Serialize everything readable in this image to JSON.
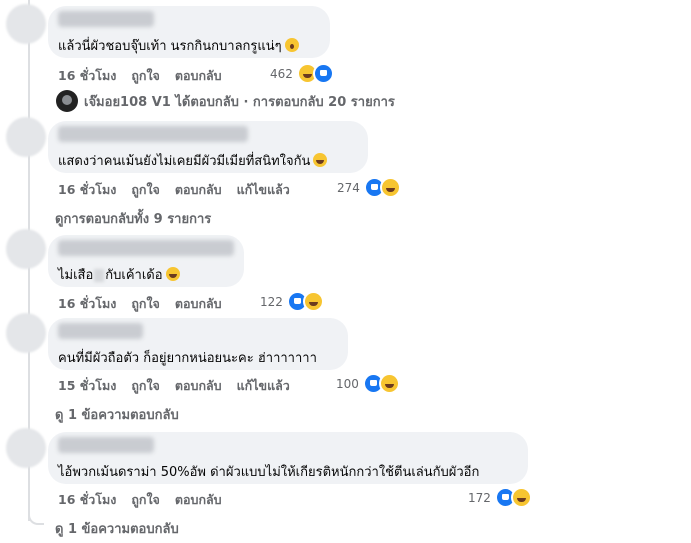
{
  "comments": [
    {
      "text": "แล้วนี่ผัวชอบจุ๊บเท้า นรกกินกบาลกรูแน่ๆ",
      "emoji": "shocked-emoji",
      "time": "16 ชั่วโมง",
      "like": "ถูกใจ",
      "reply": "ตอบกลับ",
      "edited": "",
      "count": "462",
      "reactions": [
        "haha",
        "like"
      ]
    },
    {
      "text": "แสดงว่าคนเม้นยังไม่เคยมีผัวมีเมียที่สนิทใจกัน",
      "emoji": "laugh-emoji",
      "time": "16 ชั่วโมง",
      "like": "ถูกใจ",
      "reply": "ตอบกลับ",
      "edited": "แก้ไขแล้ว",
      "count": "274",
      "reactions": [
        "like",
        "haha"
      ]
    },
    {
      "text_before": "ไม่เสือ",
      "text_after": "กับเค้าเด้อ",
      "emoji": "laugh-emoji",
      "time": "16 ชั่วโมง",
      "like": "ถูกใจ",
      "reply": "ตอบกลับ",
      "edited": "",
      "count": "122",
      "reactions": [
        "like",
        "haha"
      ]
    },
    {
      "text": "คนที่มีผัวถือตัว ก็อยู่ยากหน่อยนะคะ ฮ่าาาาาาา",
      "time": "15 ชั่วโมง",
      "like": "ถูกใจ",
      "reply": "ตอบกลับ",
      "edited": "แก้ไขแล้ว",
      "count": "100",
      "reactions": [
        "like",
        "haha"
      ]
    },
    {
      "text": "ไอ้พวกเม้นดราม่า 50%อัพ ด่าผัวแบบไม่ให้เกียรติหนักกว่าใช้ตีนเล่นกับผัวอีก",
      "time": "16 ชั่วโมง",
      "like": "ถูกใจ",
      "reply": "ตอบกลับ",
      "edited": "",
      "count": "172",
      "reactions": [
        "like",
        "haha"
      ]
    }
  ],
  "replied_line": "เจ๊มอย108 V1 ได้ตอบกลับ · การตอบกลับ 20 รายการ",
  "view_all_replies": "ดูการตอบกลับทั้ง 9 รายการ",
  "view_one_reply_a": "ดู 1 ข้อความตอบกลับ",
  "view_one_reply_b": "ดู 1 ข้อความตอบกลับ"
}
